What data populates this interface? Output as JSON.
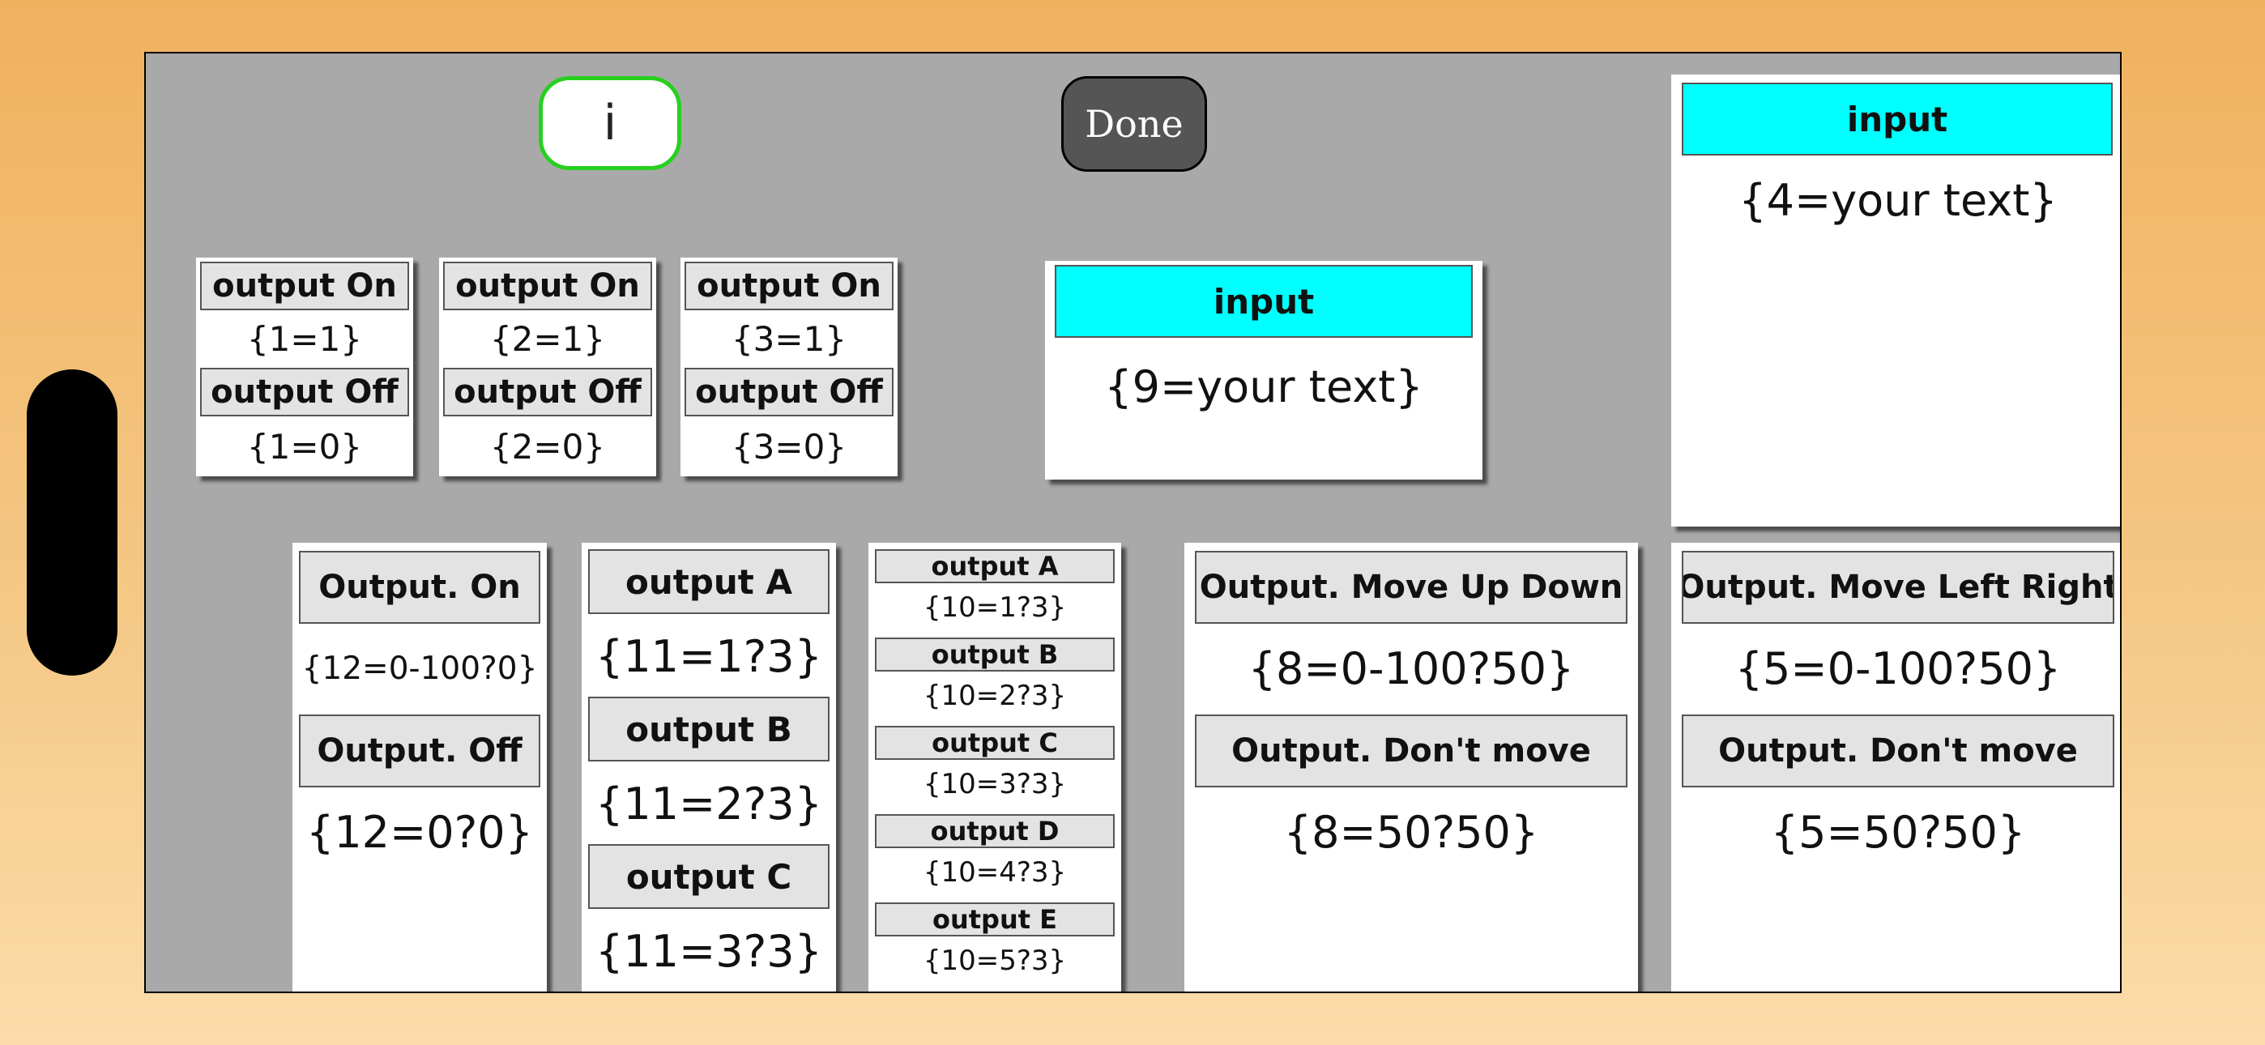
{
  "buttons": {
    "info_label": "i",
    "done_label": "Done"
  },
  "toggle_panels": [
    {
      "on_label": "output On",
      "on_value": "{1=1}",
      "off_label": "output Off",
      "off_value": "{1=0}"
    },
    {
      "on_label": "output On",
      "on_value": "{2=1}",
      "off_label": "output Off",
      "off_value": "{2=0}"
    },
    {
      "on_label": "output On",
      "on_value": "{3=1}",
      "off_label": "output Off",
      "off_value": "{3=0}"
    }
  ],
  "input_panels": [
    {
      "label": "input",
      "value": "{9=your text}"
    },
    {
      "label": "input",
      "value": "{4=your text}"
    }
  ],
  "output_12": {
    "on_label": "Output. On",
    "on_value": "{12=0-100?0}",
    "off_label": "Output. Off",
    "off_value": "{12=0?0}"
  },
  "output_11": [
    {
      "label": "output A",
      "value": "{11=1?3}"
    },
    {
      "label": "output B",
      "value": "{11=2?3}"
    },
    {
      "label": "output C",
      "value": "{11=3?3}"
    }
  ],
  "output_10": [
    {
      "label": "output A",
      "value": "{10=1?3}"
    },
    {
      "label": "output B",
      "value": "{10=2?3}"
    },
    {
      "label": "output C",
      "value": "{10=3?3}"
    },
    {
      "label": "output D",
      "value": "{10=4?3}"
    },
    {
      "label": "output E",
      "value": "{10=5?3}"
    }
  ],
  "output_8": {
    "move_label": "Output. Move Up Down",
    "move_value": "{8=0-100?50}",
    "stay_label": "Output. Don't move",
    "stay_value": "{8=50?50}"
  },
  "output_5": {
    "move_label": "Output. Move Left Right",
    "move_value": "{5=0-100?50}",
    "stay_label": "Output. Don't move",
    "stay_value": "{5=50?50}"
  },
  "colors": {
    "accent_border": "#27d01f",
    "input_header": "#00ffff",
    "done_bg": "#555555"
  }
}
